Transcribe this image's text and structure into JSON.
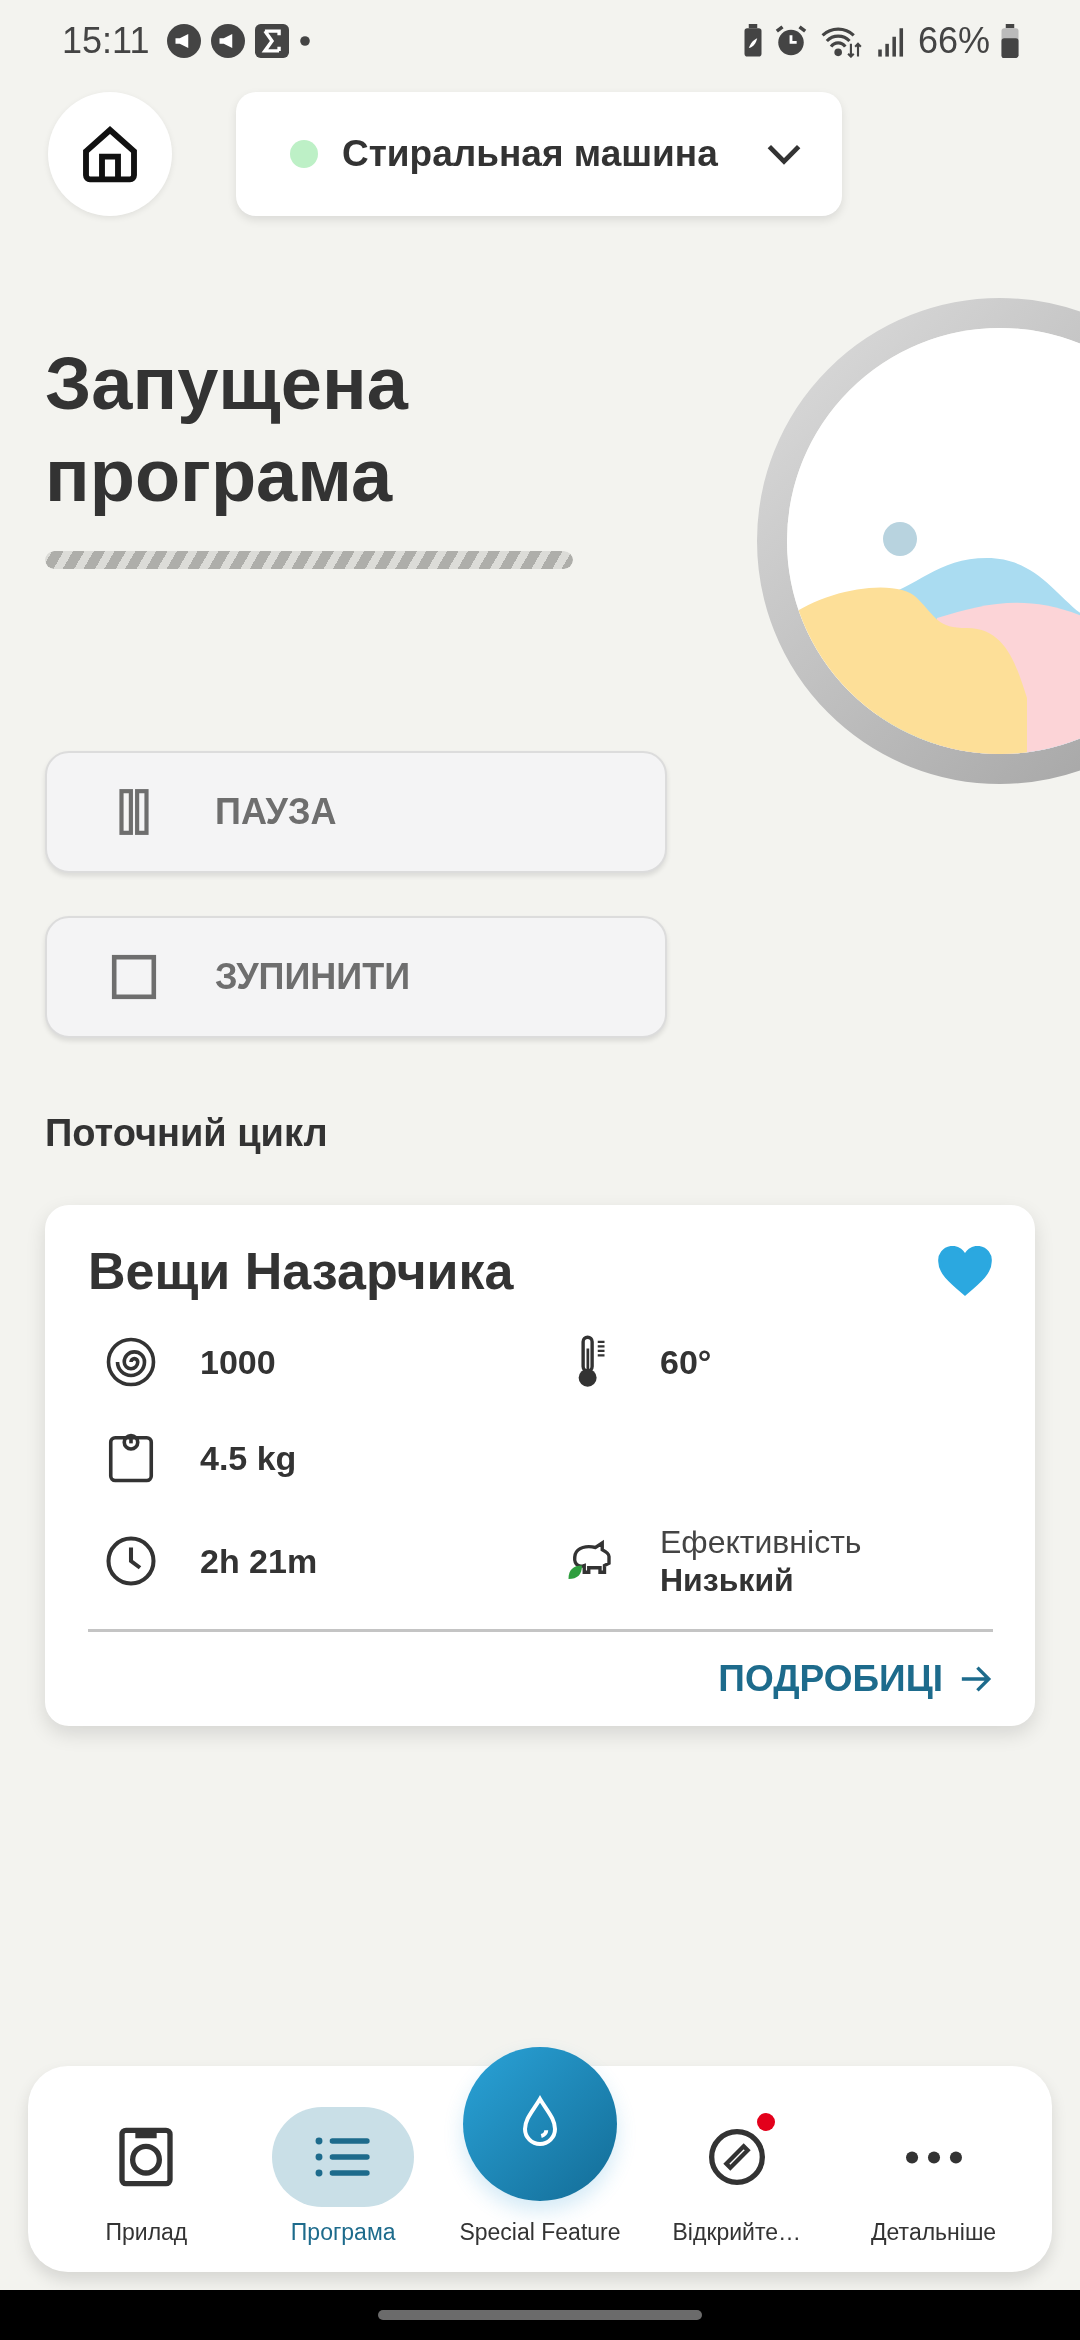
{
  "status_bar": {
    "time": "15:11",
    "battery": "66%"
  },
  "device_selector": {
    "label": "Стиральная машина",
    "connected": true
  },
  "program": {
    "title": "Запущена програма"
  },
  "buttons": [
    {
      "label": "ПАУЗА",
      "kind": "pause"
    },
    {
      "label": "ЗУПИНИТИ",
      "kind": "stop"
    }
  ],
  "section_title": "Поточний цикл",
  "cycle": {
    "name": "Вещи Назарчика",
    "favorite": true,
    "rows": [
      [
        {
          "kind": "spin",
          "value": "1000"
        },
        {
          "kind": "temperature",
          "value": "60°"
        }
      ],
      [
        {
          "kind": "weight",
          "value": "4.5 kg"
        }
      ],
      [
        {
          "kind": "duration",
          "value": "2h 21m"
        },
        {
          "kind": "efficiency",
          "label": "Ефективність",
          "value": "Низький"
        }
      ]
    ],
    "link": "ПОДРОБИЦІ"
  },
  "nav": [
    {
      "label": "Прилад",
      "kind": "appliance",
      "selected": false
    },
    {
      "label": "Програма",
      "kind": "program",
      "selected": true
    },
    {
      "label": "Special Feature",
      "kind": "special",
      "selected": false
    },
    {
      "label": "Відкрийте…",
      "kind": "discover",
      "selected": false,
      "badge": true
    },
    {
      "label": "Детальніше",
      "kind": "more",
      "selected": false
    }
  ]
}
